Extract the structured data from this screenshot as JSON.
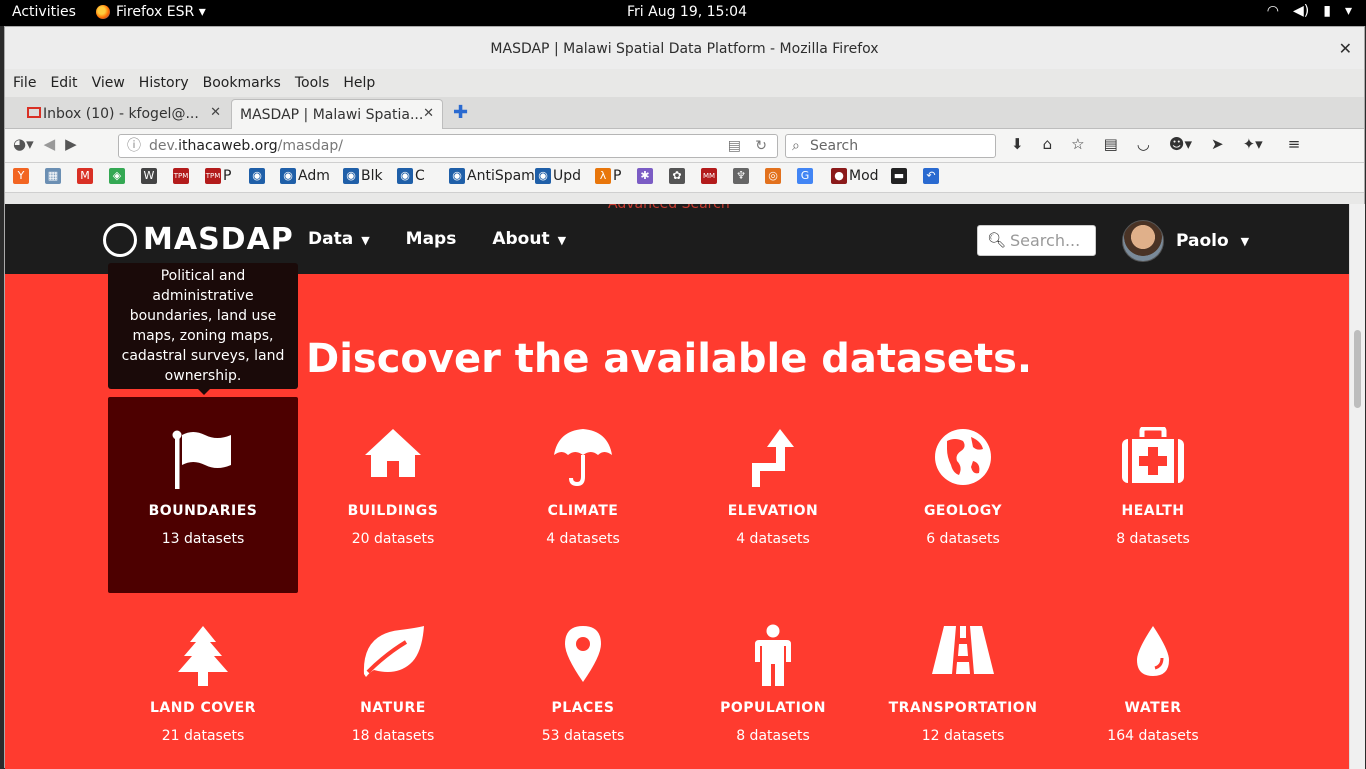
{
  "gnome": {
    "activities": "Activities",
    "app_menu": "Firefox ESR ▾",
    "clock": "Fri Aug 19, 15:04"
  },
  "window": {
    "title": "MASDAP | Malawi Spatial Data Platform - Mozilla Firefox"
  },
  "menu": [
    "File",
    "Edit",
    "View",
    "History",
    "Bookmarks",
    "Tools",
    "Help"
  ],
  "tabs": [
    {
      "label": "Inbox (10) - kfogel@..."
    },
    {
      "label": "MASDAP | Malawi Spatia..."
    }
  ],
  "urlbar": {
    "prefix": "dev.",
    "domain": "ithacaweb.org",
    "path": "/masdap/"
  },
  "ff_search": {
    "placeholder": "Search"
  },
  "bookmarks": [
    {
      "label": "",
      "icon": "Y",
      "color": "#f26522"
    },
    {
      "label": "",
      "icon": "▦",
      "color": "#6b8fb3"
    },
    {
      "label": "",
      "icon": "M",
      "color": "#d93025"
    },
    {
      "label": "",
      "icon": "◈",
      "color": "#34a853"
    },
    {
      "label": "",
      "icon": "W",
      "color": "#444444"
    },
    {
      "label": "",
      "icon": "TPM",
      "color": "#b31b1b"
    },
    {
      "label": "P",
      "icon": "TPM",
      "color": "#b31b1b"
    },
    {
      "label": "",
      "icon": "◉",
      "color": "#1f5fa8"
    },
    {
      "label": "Adm",
      "icon": "◉",
      "color": "#1f5fa8"
    },
    {
      "label": "Blk",
      "icon": "◉",
      "color": "#1f5fa8"
    },
    {
      "label": "C",
      "icon": "◉",
      "color": "#1f5fa8"
    },
    {
      "label": "AntiSpam",
      "icon": "◉",
      "color": "#1f5fa8"
    },
    {
      "label": "Upd",
      "icon": "◉",
      "color": "#1f5fa8"
    },
    {
      "label": "P",
      "icon": "λ",
      "color": "#e8760b"
    },
    {
      "label": "",
      "icon": "✱",
      "color": "#7b5cc4"
    },
    {
      "label": "",
      "icon": "✿",
      "color": "#555555"
    },
    {
      "label": "",
      "icon": "MM",
      "color": "#b31b1b"
    },
    {
      "label": "",
      "icon": "♆",
      "color": "#666666"
    },
    {
      "label": "",
      "icon": "◎",
      "color": "#e2711d"
    },
    {
      "label": "",
      "icon": "G",
      "color": "#4285f4"
    },
    {
      "label": "Mod",
      "icon": "●",
      "color": "#8b1a1a"
    },
    {
      "label": "",
      "icon": "▬",
      "color": "#222222"
    },
    {
      "label": "",
      "icon": "↶",
      "color": "#2a6ad0"
    }
  ],
  "site": {
    "ghost_text": "Advanced Search",
    "logo": "MASDAP",
    "nav": [
      {
        "label": "Data",
        "caret": true
      },
      {
        "label": "Maps",
        "caret": false
      },
      {
        "label": "About",
        "caret": true
      }
    ],
    "search_placeholder": "Search...",
    "user_name": "Paolo",
    "heading": "Discover the available datasets.",
    "tooltip": "Political and administrative boundaries, land use maps, zoning maps, cadastral surveys, land ownership.",
    "categories": [
      {
        "label": "BOUNDARIES",
        "count": "13 datasets",
        "icon": "flag-icon",
        "active": true
      },
      {
        "label": "BUILDINGS",
        "count": "20 datasets",
        "icon": "house-icon",
        "active": false
      },
      {
        "label": "CLIMATE",
        "count": "4 datasets",
        "icon": "umbrella-icon",
        "active": false
      },
      {
        "label": "ELEVATION",
        "count": "4 datasets",
        "icon": "turn-up-arrow-icon",
        "active": false
      },
      {
        "label": "GEOLOGY",
        "count": "6 datasets",
        "icon": "globe-icon",
        "active": false
      },
      {
        "label": "HEALTH",
        "count": "8 datasets",
        "icon": "medkit-icon",
        "active": false
      },
      {
        "label": "LAND COVER",
        "count": "21 datasets",
        "icon": "tree-icon",
        "active": false
      },
      {
        "label": "NATURE",
        "count": "18 datasets",
        "icon": "leaf-icon",
        "active": false
      },
      {
        "label": "PLACES",
        "count": "53 datasets",
        "icon": "map-pin-icon",
        "active": false
      },
      {
        "label": "POPULATION",
        "count": "8 datasets",
        "icon": "person-icon",
        "active": false
      },
      {
        "label": "TRANSPORTATION",
        "count": "12 datasets",
        "icon": "road-icon",
        "active": false
      },
      {
        "label": "WATER",
        "count": "164 datasets",
        "icon": "water-drop-icon",
        "active": false
      }
    ]
  },
  "colors": {
    "page_bg": "#ff3b2f",
    "header_bg": "#1c1c1c",
    "active_card": "#4d0000"
  }
}
